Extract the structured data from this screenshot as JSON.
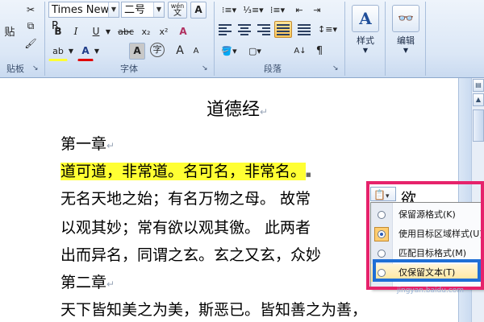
{
  "ribbon": {
    "clipboard": {
      "paste_label": "贴",
      "group_label": "贴板",
      "launcher": "↘"
    },
    "font": {
      "font_name": "Times New R",
      "font_size": "二号",
      "wen_label": "wén",
      "wen_char": "文",
      "a_box_label": "A",
      "bold": "B",
      "italic": "I",
      "underline": "U",
      "strike": "abc",
      "subscript": "x₂",
      "superscript": "x²",
      "clear": "A",
      "highlight": "ab",
      "font_color": "A",
      "char_shading": "A",
      "enclose": "字",
      "grow": "A",
      "shrink": "A",
      "group_label": "字体",
      "launcher": "↘"
    },
    "paragraph": {
      "group_label": "段落",
      "launcher": "↘",
      "sort": "A↓",
      "marks": "¶"
    },
    "styles": {
      "label": "样式",
      "icon": "A"
    },
    "editing": {
      "label": "编辑",
      "icon": "⌘"
    }
  },
  "document": {
    "title": "道德经",
    "lines": [
      "第一章",
      "道可道，非常道。名可名，非常名。",
      "无名天地之始；有名万物之母。 故常",
      "以观其妙；常有欲以观其徼。 此两者",
      "出而异名，同谓之玄。玄之又玄，众妙",
      "第二章",
      "天下皆知美之为美，斯恶已。皆知善之为善，"
    ],
    "tail_yu": "欲",
    "para_mark": "↵",
    "end_mark": "■"
  },
  "paste_options": {
    "button_icon": "📋",
    "button_arrow": "▾",
    "items": [
      {
        "label": "保留源格式(K)",
        "selected": false
      },
      {
        "label": "使用目标区域样式(U)",
        "selected": true
      },
      {
        "label": "匹配目标格式(M)",
        "selected": false
      },
      {
        "label": "仅保留文本(T)",
        "selected": false
      }
    ]
  },
  "watermark": "jingyan.baidu.com",
  "colors": {
    "highlight": "#ffff33",
    "pink": "#e6226b",
    "blue": "#1f6fd6",
    "font_color_bar": "#e00000"
  }
}
